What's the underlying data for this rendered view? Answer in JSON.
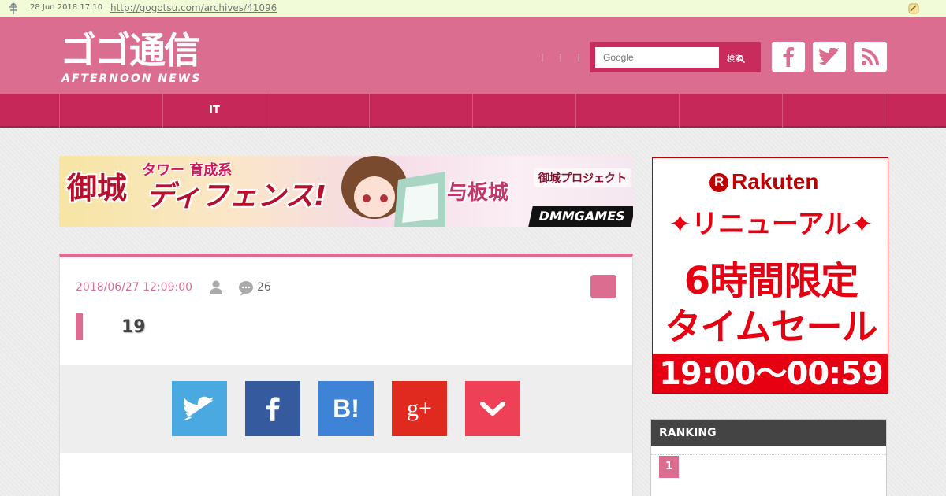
{
  "archive_bar": {
    "date": "28 Jun 2018 17:10",
    "url": "http://gogotsu.com/archives/41096"
  },
  "header": {
    "logo_main": "ゴゴ通信",
    "logo_sub": "AFTERNOON NEWS",
    "dots": "| | |",
    "search": {
      "placeholder": "Google",
      "button_label": "検索"
    },
    "social": [
      "facebook-icon",
      "twitter-icon",
      "rss-icon"
    ]
  },
  "nav": {
    "items": [
      "",
      "IT",
      "",
      "",
      "",
      "",
      "",
      ""
    ]
  },
  "banner": {
    "tag": "タワー 育成系",
    "left_text": "御城",
    "left_text2": "ディフェンス!",
    "mid_text": "与板城",
    "game_logo": "御城プロジェクト",
    "brand": "DMMGAMES"
  },
  "article": {
    "date": "2018/06/27 12:09:00",
    "comment_count": "26",
    "title": "19"
  },
  "share": {
    "buttons": [
      {
        "name": "twitter",
        "color": "#4ba9e1"
      },
      {
        "name": "facebook",
        "color": "#355b9e"
      },
      {
        "name": "hatena",
        "color": "#3e83d6",
        "label": "B!"
      },
      {
        "name": "google-plus",
        "color": "#e02a20",
        "label": "g+"
      },
      {
        "name": "pocket",
        "color": "#ee4056"
      }
    ]
  },
  "rakuten_ad": {
    "brand": "Rakuten",
    "brand_mark": "R",
    "line1": "✦リニューアル✦",
    "line2": "6時間限定",
    "line3": "タイムセール",
    "time": "19:00〜00:59"
  },
  "ranking": {
    "heading": "RANKING",
    "first_rank": "1"
  },
  "colors": {
    "accent": "#db6d91",
    "nav": "#c7285a",
    "rakuten_red": "#e60012"
  }
}
